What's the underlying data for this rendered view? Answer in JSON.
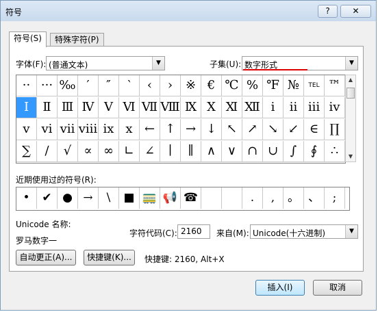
{
  "dialog": {
    "title": "符号",
    "help_label": "?",
    "close_label": "✕"
  },
  "tabs": [
    {
      "label": "符号(S)"
    },
    {
      "label": "特殊字符(P)"
    }
  ],
  "font": {
    "label": "字体(F):",
    "value": "(普通文本)"
  },
  "subset": {
    "label": "子集(U):",
    "value": "数字形式"
  },
  "symbols": [
    "··",
    "···",
    "‰",
    "′",
    "″",
    "‵",
    "‹",
    "›",
    "※",
    "€",
    "℃",
    "%",
    "℉",
    "№",
    "TEL",
    "™",
    "Ⅰ",
    "Ⅱ",
    "Ⅲ",
    "Ⅳ",
    "Ⅴ",
    "Ⅵ",
    "Ⅶ",
    "Ⅷ",
    "Ⅸ",
    "Ⅹ",
    "Ⅺ",
    "Ⅻ",
    "ⅰ",
    "ⅱ",
    "ⅲ",
    "ⅳ",
    "ⅴ",
    "ⅵ",
    "ⅶ",
    "ⅷ",
    "ⅸ",
    "ⅹ",
    "←",
    "↑",
    "→",
    "↓",
    "↖",
    "↗",
    "↘",
    "↙",
    "∈",
    "∏",
    "∑",
    "∕",
    "√",
    "∝",
    "∞",
    "∟",
    "∠",
    "∣",
    "∥",
    "∧",
    "∨",
    "∩",
    "∪",
    "∫",
    "∮",
    "∴"
  ],
  "selected_symbol_index": 16,
  "recent": {
    "label": "近期使用过的符号(R):",
    "symbols": [
      "•",
      "✔",
      "●",
      "→",
      "\\",
      "■",
      "🚃",
      "📢",
      "☎",
      "",
      "",
      ".",
      ",",
      "。",
      "、",
      ";"
    ]
  },
  "unicode_name": {
    "label": "Unicode 名称:",
    "value": "罗马数字一"
  },
  "char_code": {
    "label": "字符代码(C):",
    "value": "2160"
  },
  "from": {
    "label": "来自(M):",
    "value": "Unicode(十六进制)"
  },
  "buttons": {
    "autocorrect": "自动更正(A)...",
    "shortcut": "快捷键(K)...",
    "shortcut_info": "快捷键: 2160, Alt+X",
    "insert": "插入(I)",
    "cancel": "取消"
  }
}
